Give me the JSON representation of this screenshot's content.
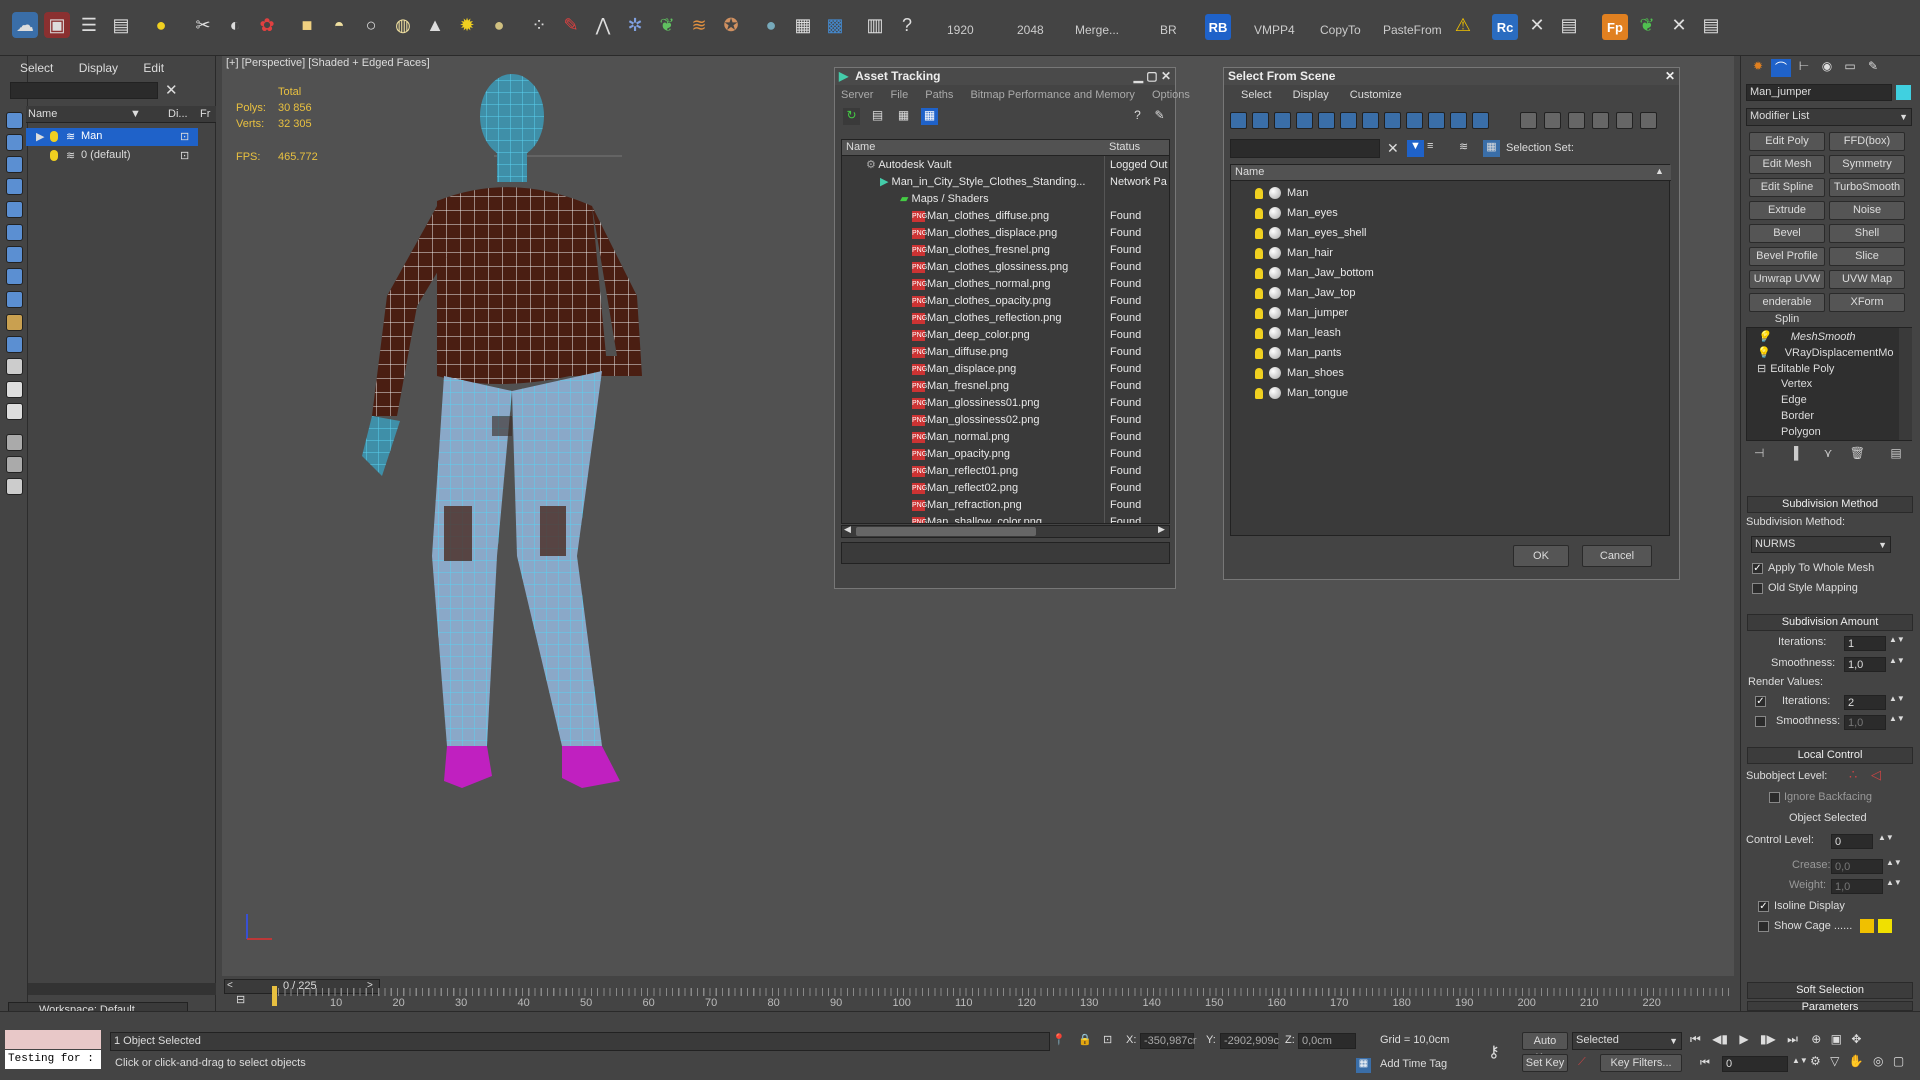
{
  "toolbar": {
    "texts": [
      "1920",
      "2048",
      "Merge...",
      "BR",
      "VMPP4",
      "CopyTo",
      "PasteFrom"
    ],
    "rb_label": "RB",
    "rc_label": "Rc",
    "fp_label": "Fp"
  },
  "explorer": {
    "menu": [
      "Select",
      "Display",
      "Edit"
    ],
    "col_name": "Name",
    "col_di": "Di...",
    "col_fr": "Fr",
    "items": [
      {
        "label": "Man",
        "selected": true
      },
      {
        "label": "0 (default)",
        "selected": false
      }
    ],
    "workspace": "Workspace: Default"
  },
  "viewport": {
    "label": "[+] [Perspective] [Shaded + Edged Faces]",
    "stats_total": "Total",
    "polys_label": "Polys:",
    "polys_value": "30 856",
    "verts_label": "Verts:",
    "verts_value": "32 305",
    "fps_label": "FPS:",
    "fps_value": "465.772"
  },
  "asset_tracking": {
    "title": "Asset Tracking",
    "menu": [
      "Server",
      "File",
      "Paths",
      "Bitmap Performance and Memory",
      "Options"
    ],
    "col_name": "Name",
    "col_status": "Status",
    "vault": {
      "name": "Autodesk Vault",
      "status": "Logged Out"
    },
    "scene_file": {
      "name": "Man_in_City_Style_Clothes_Standing...",
      "status": "Network Pa"
    },
    "maps_group": "Maps / Shaders",
    "files": [
      {
        "name": "Man_clothes_diffuse.png",
        "status": "Found"
      },
      {
        "name": "Man_clothes_displace.png",
        "status": "Found"
      },
      {
        "name": "Man_clothes_fresnel.png",
        "status": "Found"
      },
      {
        "name": "Man_clothes_glossiness.png",
        "status": "Found"
      },
      {
        "name": "Man_clothes_normal.png",
        "status": "Found"
      },
      {
        "name": "Man_clothes_opacity.png",
        "status": "Found"
      },
      {
        "name": "Man_clothes_reflection.png",
        "status": "Found"
      },
      {
        "name": "Man_deep_color.png",
        "status": "Found"
      },
      {
        "name": "Man_diffuse.png",
        "status": "Found"
      },
      {
        "name": "Man_displace.png",
        "status": "Found"
      },
      {
        "name": "Man_fresnel.png",
        "status": "Found"
      },
      {
        "name": "Man_glossiness01.png",
        "status": "Found"
      },
      {
        "name": "Man_glossiness02.png",
        "status": "Found"
      },
      {
        "name": "Man_normal.png",
        "status": "Found"
      },
      {
        "name": "Man_opacity.png",
        "status": "Found"
      },
      {
        "name": "Man_reflect01.png",
        "status": "Found"
      },
      {
        "name": "Man_reflect02.png",
        "status": "Found"
      },
      {
        "name": "Man_refraction.png",
        "status": "Found"
      },
      {
        "name": "Man_shallow_color.png",
        "status": "Found"
      }
    ]
  },
  "select_scene": {
    "title": "Select From Scene",
    "menu": [
      "Select",
      "Display",
      "Customize"
    ],
    "selection_set_label": "Selection Set:",
    "col_name": "Name",
    "objects": [
      "Man",
      "Man_eyes",
      "Man_eyes_shell",
      "Man_hair",
      "Man_Jaw_bottom",
      "Man_Jaw_top",
      "Man_jumper",
      "Man_leash",
      "Man_pants",
      "Man_shoes",
      "Man_tongue"
    ],
    "ok": "OK",
    "cancel": "Cancel"
  },
  "command_panel": {
    "object_name": "Man_jumper",
    "modifier_list": "Modifier List",
    "buttons": [
      [
        "Edit Poly",
        "FFD(box)"
      ],
      [
        "Edit Mesh",
        "Symmetry"
      ],
      [
        "Edit Spline",
        "TurboSmooth"
      ],
      [
        "Extrude",
        "Noise"
      ],
      [
        "Bevel",
        "Shell"
      ],
      [
        "Bevel Profile",
        "Slice"
      ],
      [
        "Unwrap UVW",
        "UVW Map"
      ],
      [
        "enderable Splin",
        "XForm"
      ]
    ],
    "stack": [
      "MeshSmooth",
      "VRayDisplacementMo",
      "Editable Poly",
      "Vertex",
      "Edge",
      "Border",
      "Polygon"
    ],
    "subdivision_method_title": "Subdivision Method",
    "subdivision_method_label": "Subdivision Method:",
    "subdivision_method_value": "NURMS",
    "apply_whole_mesh": "Apply To Whole Mesh",
    "old_style_mapping": "Old Style Mapping",
    "subdivision_amount_title": "Subdivision Amount",
    "iterations_label": "Iterations:",
    "iterations_value": "1",
    "smoothness_label": "Smoothness:",
    "smoothness_value": "1,0",
    "render_values_label": "Render Values:",
    "render_iterations_value": "2",
    "render_smoothness_value": "1,0",
    "local_control_title": "Local Control",
    "subobject_level_label": "Subobject Level:",
    "ignore_backfacing": "Ignore Backfacing",
    "object_selected": "Object Selected",
    "control_level_label": "Control Level:",
    "control_level_value": "0",
    "crease_label": "Crease:",
    "crease_value": "0,0",
    "weight_label": "Weight:",
    "weight_value": "1,0",
    "isoline_display": "Isoline Display",
    "show_cage": "Show Cage ......",
    "soft_selection_title": "Soft Selection",
    "parameters_title": "Parameters"
  },
  "timeline": {
    "frame_counter": "0 / 225",
    "ticks": [
      "10",
      "20",
      "30",
      "40",
      "50",
      "60",
      "70",
      "80",
      "90",
      "100",
      "110",
      "120",
      "130",
      "140",
      "150",
      "160",
      "170",
      "180",
      "190",
      "200",
      "210",
      "220"
    ]
  },
  "status": {
    "maxscript_text": "Testing for :",
    "selection_text": "1 Object Selected",
    "prompt_text": "Click or click-and-drag to select objects",
    "x_label": "X:",
    "x_value": "-350,987cr",
    "y_label": "Y:",
    "y_value": "-2902,909c",
    "z_label": "Z:",
    "z_value": "0,0cm",
    "grid": "Grid = 10,0cm",
    "add_time_tag": "Add Time Tag",
    "auto_key": "Auto Key",
    "set_key": "Set Key",
    "key_mode": "Selected",
    "key_filters": "Key Filters...",
    "frame_value": "0"
  },
  "colors": {
    "accent_blue": "#1f62c9",
    "wire_cyan": "#5ad0f0",
    "shirt_brown": "#4a1e12",
    "jeans_blue": "#8aa8c8",
    "shoe_magenta": "#c020c0",
    "stats_yellow": "#e8c040",
    "warning_yellow": "#f0c000"
  }
}
